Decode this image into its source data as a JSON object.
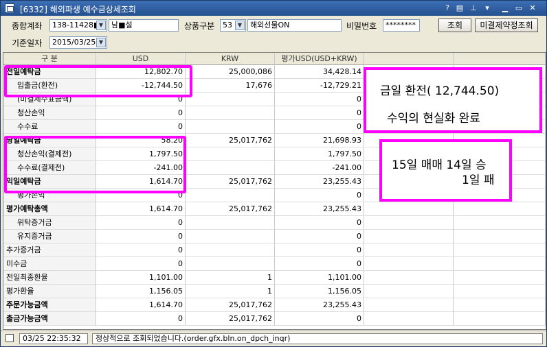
{
  "window": {
    "title": "[6332] 해외파생 예수금상세조회",
    "help": "?"
  },
  "form": {
    "account_label": "종합계좌",
    "account_number": "138-11428■",
    "account_name": "남■설",
    "product_label": "상품구분",
    "product_code": "53",
    "product_name": "해외선물ON",
    "password_label": "비밀번호",
    "password_value": "********",
    "query_button": "조회",
    "unsettled_button": "미결제약정조회",
    "date_label": "기준일자",
    "date_value": "2015/03/25"
  },
  "table": {
    "headers": [
      "구 분",
      "USD",
      "KRW",
      "평가USD(USD+KRW)",
      "",
      ""
    ],
    "rows": [
      [
        "전일예탁금",
        "12,802.70",
        "25,000,086",
        "34,428.14"
      ],
      [
        "입출금(환전)",
        "-12,744.50",
        "17,676",
        "-12,729.21"
      ],
      [
        "(미결제수표금액)",
        "0",
        "",
        "0"
      ],
      [
        "청산손익",
        "0",
        "",
        "0"
      ],
      [
        "수수료",
        "0",
        "",
        "0"
      ],
      [
        "당일예탁금",
        "58.20",
        "25,017,762",
        "21,698.93"
      ],
      [
        "청산손익(결제전)",
        "1,797.50",
        "",
        "1,797.50"
      ],
      [
        "수수료(결제전)",
        "-241.00",
        "",
        "-241.00"
      ],
      [
        "익일예탁금",
        "1,614.70",
        "25,017,762",
        "23,255.43"
      ],
      [
        "평가손익",
        "0",
        "",
        "0"
      ],
      [
        "평가예탁총액",
        "1,614.70",
        "25,017,762",
        "23,255.43"
      ],
      [
        "위탁증거금",
        "0",
        "",
        "0"
      ],
      [
        "유지증거금",
        "0",
        "",
        "0"
      ],
      [
        "추가증거금",
        "0",
        "",
        "0"
      ],
      [
        "미수금",
        "0",
        "",
        "0"
      ],
      [
        "전일최종환율",
        "1,101.00",
        "1",
        "1,101.00"
      ],
      [
        "평가환율",
        "1,156.05",
        "1",
        "1,156.05"
      ],
      [
        "주문가능금액",
        "1,614.70",
        "25,017,762",
        "23,255.43"
      ],
      [
        "출금가능금액",
        "0",
        "25,017,762",
        "0"
      ]
    ]
  },
  "annotations": {
    "note1_line1": "금일 환전( 12,744.50)",
    "note1_line2": "수익의 현실화 완료",
    "note2_line1": "15일 매매 14일 승",
    "note2_line2": "1일 패"
  },
  "status": {
    "time": "03/25 22:35:32",
    "message": "정상적으로 조회되었습니다.(order.gfx.bln.on_dpch_inqr)"
  },
  "colors": {
    "highlight": "#ff00ff",
    "titlebar": "#2f5f9f"
  }
}
